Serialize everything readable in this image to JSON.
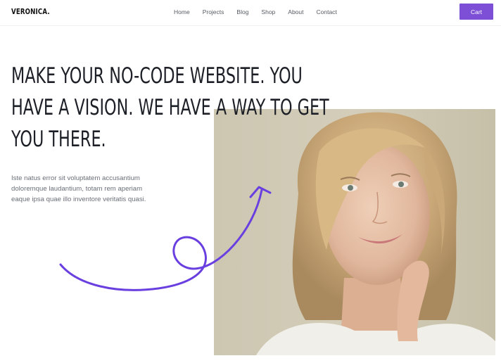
{
  "header": {
    "logo": "VERONICA.",
    "nav": [
      {
        "label": "Home"
      },
      {
        "label": "Projects"
      },
      {
        "label": "Blog"
      },
      {
        "label": "Shop"
      },
      {
        "label": "About"
      },
      {
        "label": "Contact"
      }
    ],
    "cart_label": "Cart"
  },
  "hero": {
    "headline": "MAKE YOUR NO-CODE WEBSITE. YOU HAVE A VISION. WE HAVE A WAY TO GET YOU THERE.",
    "body": "Iste natus error sit voluptatem accusantium doloremque laudantium, totam rem aperiam eaque ipsa quae illo inventore veritatis quasi."
  },
  "colors": {
    "accent": "#7c4fd6",
    "headline": "#1c1f26",
    "body": "#6a6f78"
  },
  "icons": {
    "arrow": "curly-arrow-icon"
  }
}
